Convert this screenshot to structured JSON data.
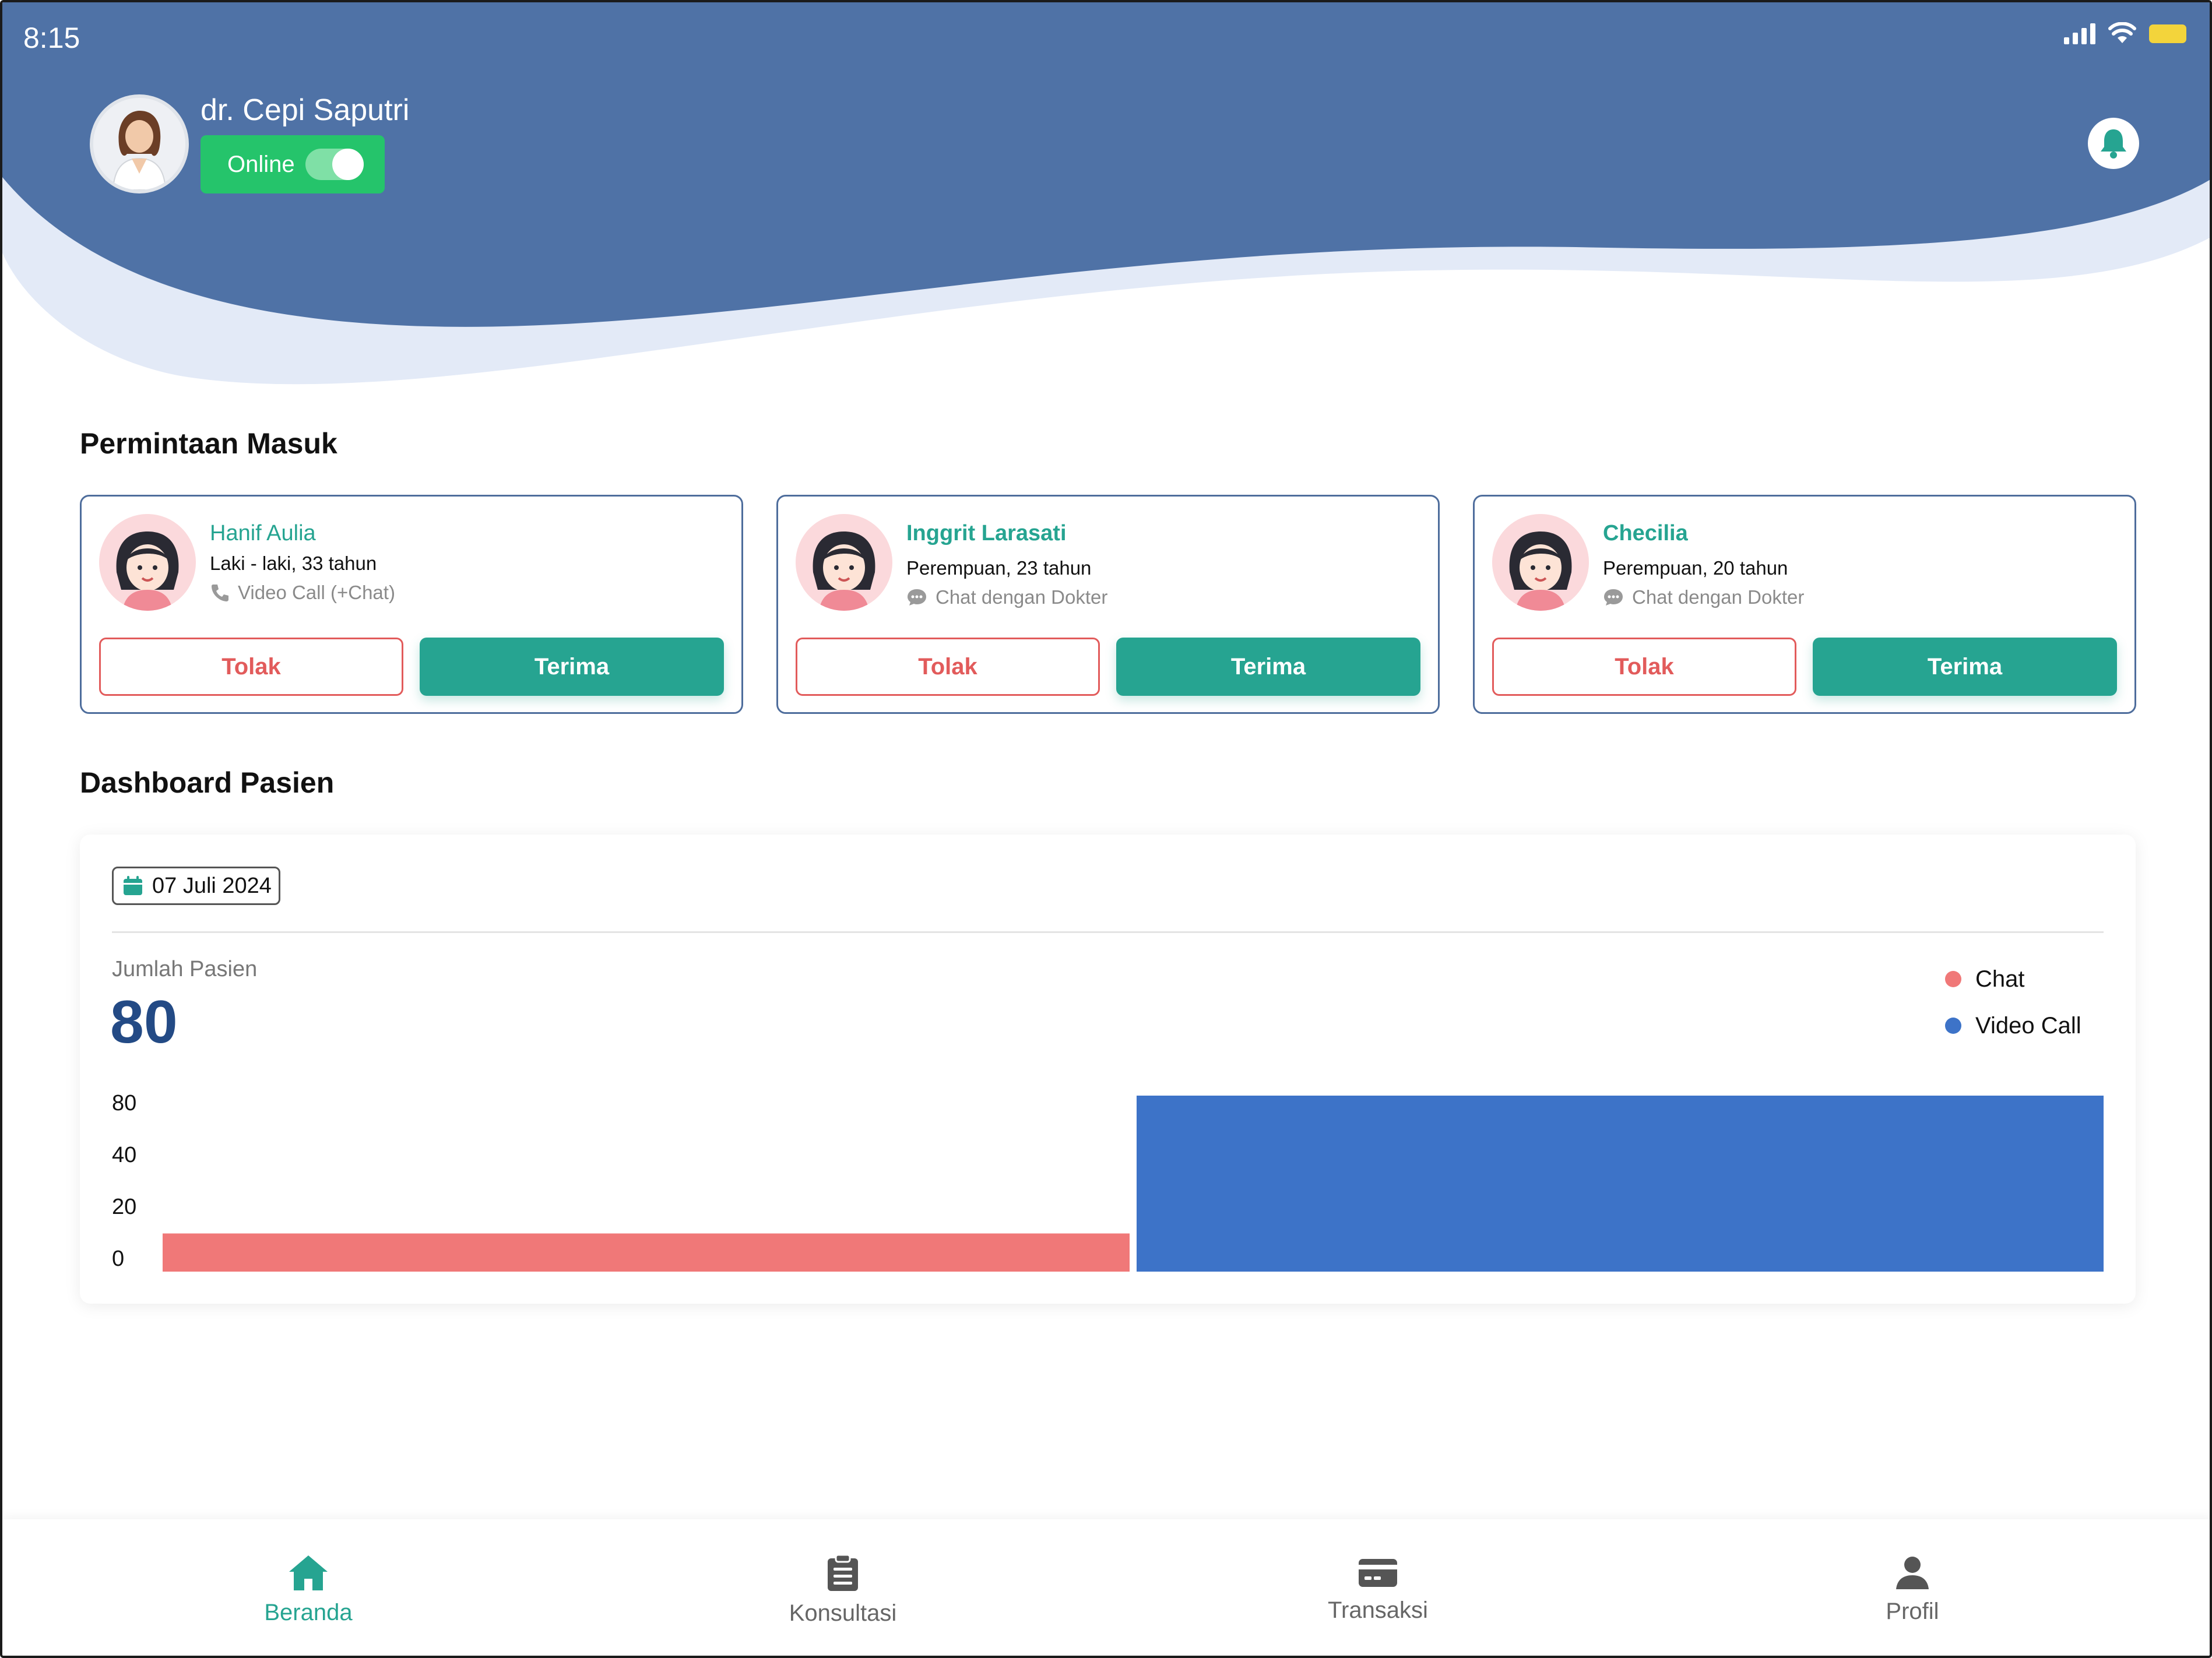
{
  "status_bar": {
    "time": "8:15"
  },
  "doctor": {
    "name": "dr. Cepi Saputri",
    "status_label": "Online",
    "online": true
  },
  "requests": {
    "title": "Permintaan Masuk",
    "items": [
      {
        "name": "Hanif Aulia",
        "info": "Laki - laki, 33 tahun",
        "type": "Video Call (+Chat)",
        "type_icon": "phone-icon",
        "reject_label": "Tolak",
        "accept_label": "Terima"
      },
      {
        "name": "Inggrit Larasati",
        "info": "Perempuan, 23 tahun",
        "type": "Chat dengan Dokter",
        "type_icon": "chat-bubble-icon",
        "reject_label": "Tolak",
        "accept_label": "Terima"
      },
      {
        "name": "Checilia",
        "info": "Perempuan, 20 tahun",
        "type": "Chat dengan Dokter",
        "type_icon": "chat-bubble-icon",
        "reject_label": "Tolak",
        "accept_label": "Terima"
      }
    ]
  },
  "dashboard": {
    "title": "Dashboard Pasien",
    "date": "07 Juli 2024",
    "total_label": "Jumlah Pasien",
    "total_value": "80"
  },
  "chart_data": {
    "type": "bar",
    "categories": [
      "Chat",
      "Video Call"
    ],
    "values": [
      18,
      83
    ],
    "colors": [
      "#f07878",
      "#3d73c8"
    ],
    "yticks": [
      "0",
      "20",
      "40",
      "80"
    ],
    "legend": [
      "Chat",
      "Video Call"
    ],
    "legend_placement": "top-right",
    "grid": false,
    "title": "",
    "xlabel": "",
    "ylabel": ""
  },
  "nav": {
    "items": [
      {
        "label": "Beranda",
        "icon": "home-icon",
        "active": true
      },
      {
        "label": "Konsultasi",
        "icon": "clipboard-icon",
        "active": false
      },
      {
        "label": "Transaksi",
        "icon": "card-icon",
        "active": false
      },
      {
        "label": "Profil",
        "icon": "person-icon",
        "active": false
      }
    ]
  },
  "colors": {
    "header": "#4f72a6",
    "header_wave": "#e3eaf7",
    "accent": "#26a491",
    "reject": "#e25b5b",
    "online": "#25c46b",
    "total_value": "#234a85"
  }
}
